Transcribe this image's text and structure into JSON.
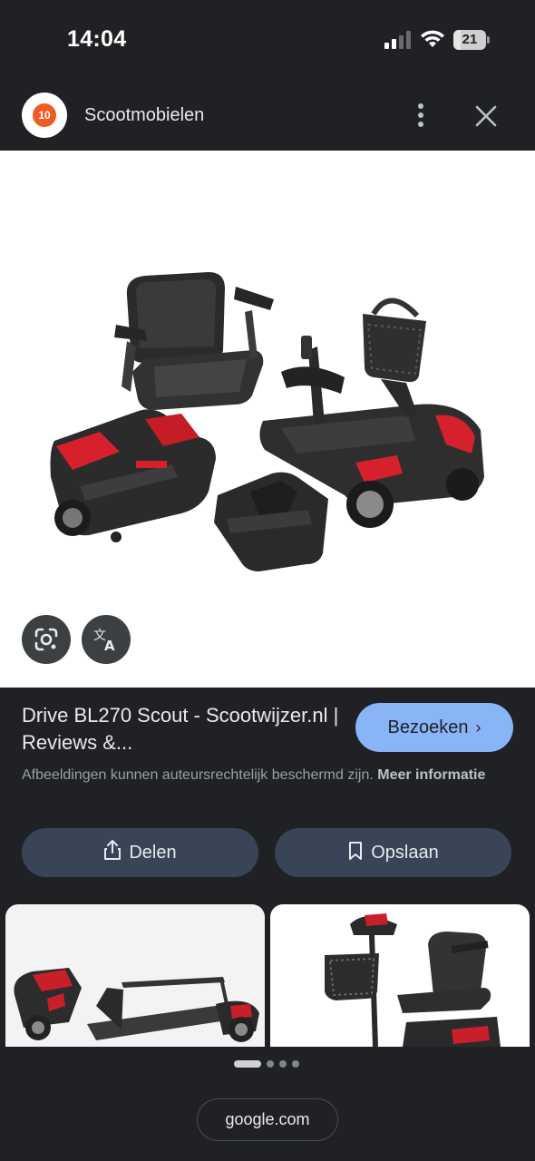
{
  "status_bar": {
    "time": "14:04",
    "battery_level": "21",
    "battery_fraction": 0.21,
    "signal_icon": "cellular-signal-icon",
    "wifi_icon": "wifi-icon"
  },
  "header": {
    "logo_text": "10",
    "title": "Scootmobielen",
    "menu_icon": "more-vert-icon",
    "close_icon": "close-icon"
  },
  "image_viewer": {
    "lens_icon": "google-lens-icon",
    "translate_icon": "translate-icon"
  },
  "result": {
    "title": "Drive BL270 Scout - Scootwijzer.nl | Reviews &...",
    "visit_label": "Bezoeken",
    "copyright_text": "Afbeeldingen kunnen auteursrechtelijk beschermd zijn.",
    "more_info_label": "Meer informatie"
  },
  "actions": {
    "share_label": "Delen",
    "save_label": "Opslaan"
  },
  "pager": {
    "total": 4,
    "active_index": 0
  },
  "footer": {
    "url": "google.com"
  },
  "colors": {
    "background": "#202124",
    "accent_button": "#8ab4f8",
    "action_button": "#394457",
    "scooter_red": "#d6202c"
  }
}
